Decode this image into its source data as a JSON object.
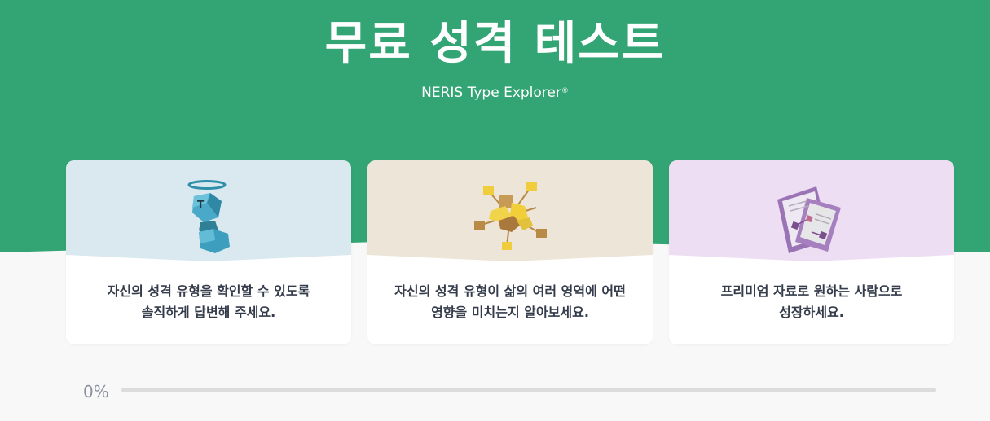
{
  "page": {
    "title": "무료 성격 테스트",
    "subtitle": "NERIS Type Explorer",
    "subtitle_mark": "®"
  },
  "cards": [
    {
      "line1": "자신의 성격 유형을 확인할 수 있도록",
      "line2": "솔직하게 답변해 주세요.",
      "icon": "cube-figure-halo-icon",
      "color": "#dae9f0"
    },
    {
      "line1": "자신의 성격 유형이 삶의 여러 영역에 어떤",
      "line2": "영향을 미치는지 알아보세요.",
      "icon": "connected-cubes-icon",
      "color": "#ede5d8"
    },
    {
      "line1": "프리미엄 자료로 원하는 사람으로",
      "line2": "성장하세요.",
      "icon": "documents-icon",
      "color": "#eddef4"
    }
  ],
  "progress": {
    "label": "0%",
    "value": 0
  },
  "colors": {
    "brand_green": "#33a474",
    "background": "#f8f8f8",
    "text_dark": "#343c4b",
    "progress_track": "#dcdcdc"
  }
}
